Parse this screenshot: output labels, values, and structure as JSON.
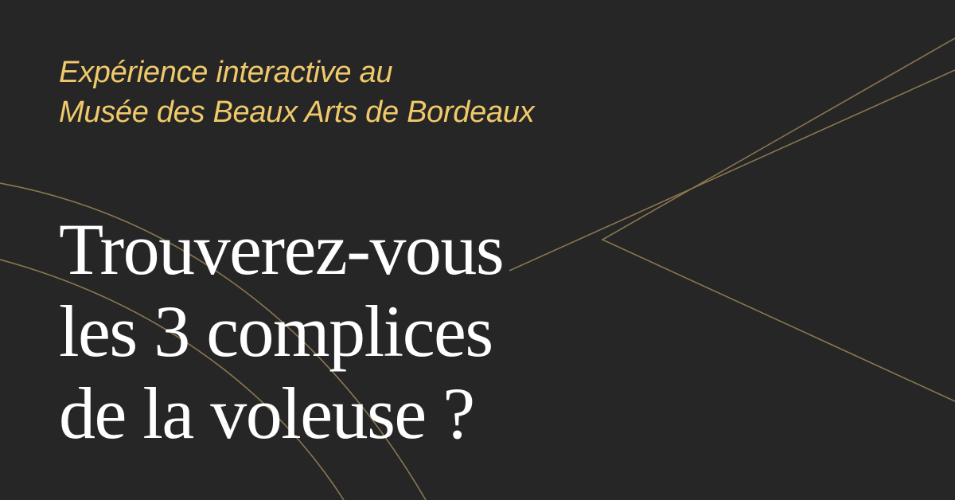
{
  "subtitle": {
    "line1": "Expérience interactive au",
    "line2": "Musée des Beaux Arts de Bordeaux"
  },
  "headline": {
    "line1": "Trouverez-vous",
    "line2": "les 3 complices",
    "line3": "de la voleuse ?"
  },
  "colors": {
    "background": "#262626",
    "subtitle": "#f0c96b",
    "headline": "#ffffff",
    "decorative_lines": "#8a7650"
  }
}
